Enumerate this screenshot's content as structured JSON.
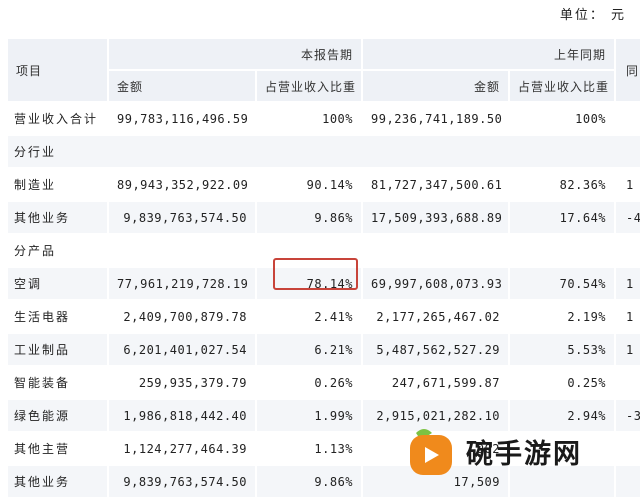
{
  "unit_label": "单位：  元",
  "header": {
    "project": "项目",
    "current_period": "本报告期",
    "prior_period": "上年同期",
    "yoy_clipped": "同",
    "amount": "金额",
    "ratio": "占营业收入比重"
  },
  "rows": [
    {
      "type": "data",
      "label": "营业收入合计",
      "cur_amount": "99,783,116,496.59",
      "cur_ratio": "100%",
      "prev_amount": "99,236,741,189.50",
      "prev_ratio": "100%",
      "yoy": ""
    },
    {
      "type": "section",
      "label": "分行业"
    },
    {
      "type": "data",
      "label": "制造业",
      "cur_amount": "89,943,352,922.09",
      "cur_ratio": "90.14%",
      "prev_amount": "81,727,347,500.61",
      "prev_ratio": "82.36%",
      "yoy": "1"
    },
    {
      "type": "data",
      "label": "其他业务",
      "cur_amount": "9,839,763,574.50",
      "cur_ratio": "9.86%",
      "prev_amount": "17,509,393,688.89",
      "prev_ratio": "17.64%",
      "yoy": "-4"
    },
    {
      "type": "section",
      "label": "分产品"
    },
    {
      "type": "data",
      "label": "空调",
      "cur_amount": "77,961,219,728.19",
      "cur_ratio": "78.14%",
      "prev_amount": "69,997,608,073.93",
      "prev_ratio": "70.54%",
      "yoy": "1"
    },
    {
      "type": "data",
      "label": "生活电器",
      "cur_amount": "2,409,700,879.78",
      "cur_ratio": "2.41%",
      "prev_amount": "2,177,265,467.02",
      "prev_ratio": "2.19%",
      "yoy": "1"
    },
    {
      "type": "data",
      "label": "工业制品",
      "cur_amount": "6,201,401,027.54",
      "cur_ratio": "6.21%",
      "prev_amount": "5,487,562,527.29",
      "prev_ratio": "5.53%",
      "yoy": "1"
    },
    {
      "type": "data",
      "label": "智能装备",
      "cur_amount": "259,935,379.79",
      "cur_ratio": "0.26%",
      "prev_amount": "247,671,599.87",
      "prev_ratio": "0.25%",
      "yoy": ""
    },
    {
      "type": "data",
      "label": "绿色能源",
      "cur_amount": "1,986,818,442.40",
      "cur_ratio": "1.99%",
      "prev_amount": "2,915,021,282.10",
      "prev_ratio": "2.94%",
      "yoy": "-3"
    },
    {
      "type": "data",
      "label": "其他主营",
      "cur_amount": "1,124,277,464.39",
      "cur_ratio": "1.13%",
      "prev_amount": "902",
      "prev_ratio": "",
      "yoy": ""
    },
    {
      "type": "data",
      "label": "其他业务",
      "cur_amount": "9,839,763,574.50",
      "cur_ratio": "9.86%",
      "prev_amount": "17,509",
      "prev_ratio": "",
      "yoy": ""
    }
  ],
  "watermark": {
    "text": "碗手游网",
    "logo_colors": [
      "#f08a1c",
      "#7cc242",
      "#ffffff"
    ]
  },
  "highlight_color": "#c8443a"
}
